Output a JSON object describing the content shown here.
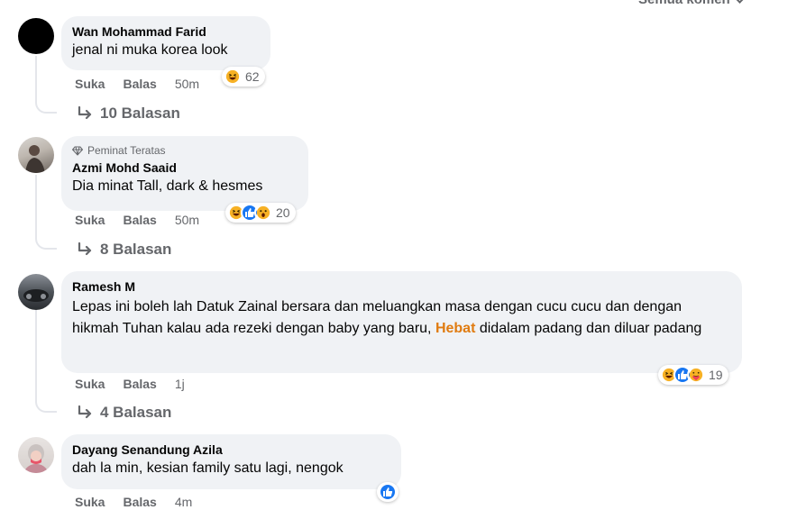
{
  "header": {
    "sort_label": "Semua komen"
  },
  "comments": [
    {
      "author": "Wan Mohammad Farid",
      "text": "jenal ni muka korea look",
      "like_label": "Suka",
      "reply_label": "Balas",
      "time": "50m",
      "reactions": [
        "haha"
      ],
      "reaction_count": "62",
      "replies_label": "10 Balasan"
    },
    {
      "badge": "Peminat Teratas",
      "author": "Azmi Mohd Saaid",
      "text": "Dia minat Tall, dark & hesmes",
      "like_label": "Suka",
      "reply_label": "Balas",
      "time": "50m",
      "reactions": [
        "haha",
        "like",
        "wow"
      ],
      "reaction_count": "20",
      "replies_label": "8 Balasan"
    },
    {
      "author": "Ramesh M",
      "text_parts": [
        "Lepas ini boleh lah Datuk Zainal bersara dan meluangkan masa dengan cucu cucu dan dengan hikmah Tuhan kalau ada rezeki dengan baby yang baru, ",
        "Hebat",
        " didalam padang dan diluar padang"
      ],
      "like_label": "Suka",
      "reply_label": "Balas",
      "time": "1j",
      "reactions": [
        "haha",
        "like",
        "care"
      ],
      "reaction_count": "19",
      "replies_label": "4 Balasan"
    },
    {
      "author": "Dayang Senandung Azila",
      "text": "dah la min, kesian family satu lagi, nengok",
      "like_label": "Suka",
      "reply_label": "Balas",
      "time": "4m",
      "reactions": [
        "like"
      ]
    }
  ],
  "colors": {
    "bubble": "#f0f2f5",
    "meta_text": "#65676b",
    "highlight": "#e07b10",
    "like_blue": "#1877f2",
    "emoji_yellow": "#f7b125"
  }
}
